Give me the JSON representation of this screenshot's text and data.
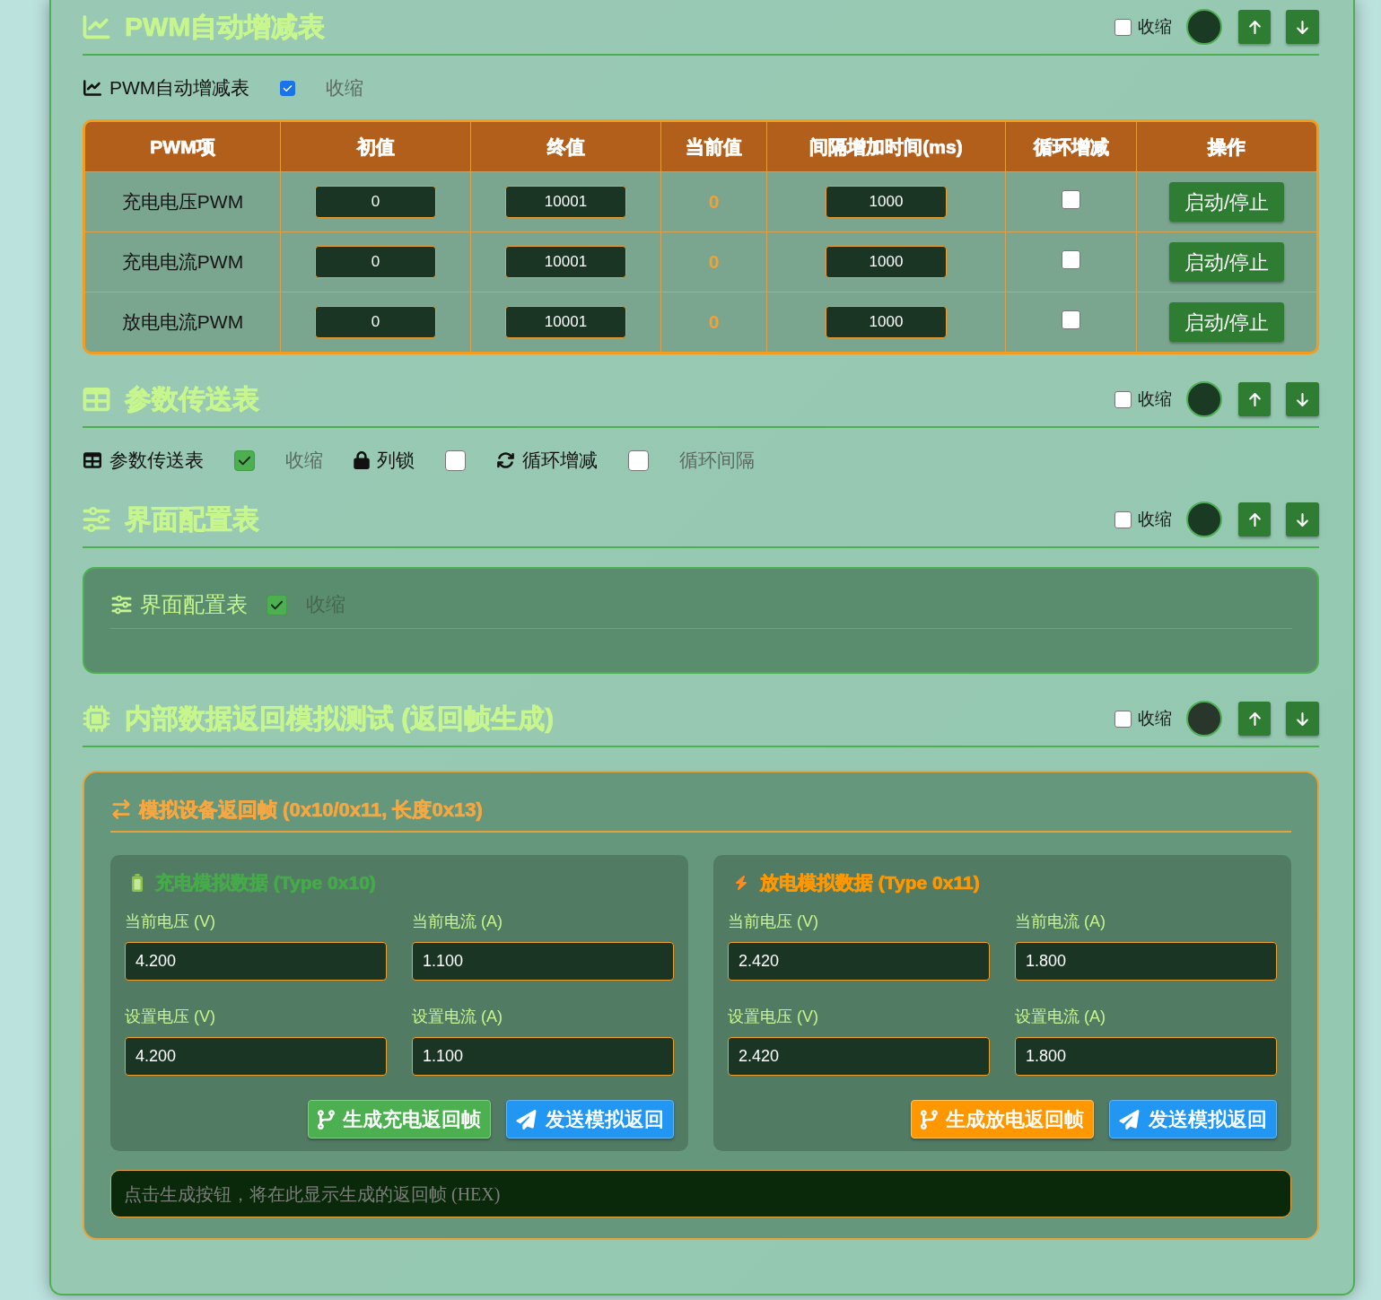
{
  "sections": [
    {
      "kind": "pwm",
      "title": "PWM自动增减表",
      "collapse": {
        "label": "收缩",
        "checked": false
      },
      "color": "#1a3a24",
      "toolbar": [
        {
          "kind": "heading",
          "label": "PWM自动增减表"
        },
        {
          "kind": "checkbox",
          "checked": true
        },
        {
          "kind": "hint",
          "label": "收缩"
        }
      ],
      "table": {
        "columns": [
          "PWM项",
          "初值",
          "终值",
          "当前值",
          "间隔增加时间(ms)",
          "循环增减",
          "操作"
        ],
        "rows": [
          {
            "name": "充电电压PWM",
            "start": "0",
            "end": "10001",
            "current": "0",
            "interval": "1000",
            "loop": false,
            "action": "启动/停止"
          },
          {
            "name": "充电电流PWM",
            "start": "0",
            "end": "10001",
            "current": "0",
            "interval": "1000",
            "loop": false,
            "action": "启动/停止"
          },
          {
            "name": "放电电流PWM",
            "start": "0",
            "end": "10001",
            "current": "0",
            "interval": "1000",
            "loop": false,
            "action": "启动/停止"
          }
        ]
      }
    },
    {
      "kind": "params",
      "title": "参数传送表",
      "collapse": {
        "label": "收缩",
        "checked": false
      },
      "color": "#1a3a24",
      "toolbar": [
        {
          "kind": "heading",
          "label": "参数传送表"
        },
        {
          "kind": "checkbox",
          "checked": true
        },
        {
          "kind": "hint",
          "label": "收缩"
        },
        {
          "kind": "lock",
          "label": "列锁"
        },
        {
          "kind": "checkbox",
          "checked": false
        },
        {
          "kind": "loop",
          "label": "循环增减"
        },
        {
          "kind": "checkbox",
          "checked": false
        },
        {
          "kind": "hint",
          "label": "循环间隔"
        }
      ]
    },
    {
      "kind": "ui_config",
      "title": "界面配置表",
      "collapse": {
        "label": "收缩",
        "checked": false
      },
      "color": "#1a3a24",
      "panel": {
        "items": [
          {
            "kind": "heading",
            "label": "界面配置表"
          },
          {
            "kind": "checkbox",
            "checked": true
          },
          {
            "kind": "hint",
            "label": "收缩"
          }
        ]
      }
    },
    {
      "kind": "simulation",
      "title": "内部数据返回模拟测试 (返回帧生成)",
      "collapse": {
        "label": "收缩",
        "checked": false
      },
      "color": "#29362b",
      "panel": {
        "title": "模拟设备返回帧 (0x10/0x11, 长度0x13)",
        "groups": [
          {
            "kind": "charge",
            "title": "充电模拟数据 (Type 0x10)",
            "fields": [
              {
                "label": "当前电压 (V)",
                "value": "4.200"
              },
              {
                "label": "当前电流 (A)",
                "value": "1.100"
              },
              {
                "label": "设置电压 (V)",
                "value": "4.200"
              },
              {
                "label": "设置电流 (A)",
                "value": "1.100"
              }
            ],
            "buttons": [
              {
                "kind": "generate",
                "label": "生成充电返回帧"
              },
              {
                "kind": "send",
                "label": "发送模拟返回"
              }
            ]
          },
          {
            "kind": "discharge",
            "title": "放电模拟数据 (Type 0x11)",
            "fields": [
              {
                "label": "当前电压 (V)",
                "value": "2.420"
              },
              {
                "label": "当前电流 (A)",
                "value": "1.800"
              },
              {
                "label": "设置电压 (V)",
                "value": "2.420"
              },
              {
                "label": "设置电流 (A)",
                "value": "1.800"
              }
            ],
            "buttons": [
              {
                "kind": "generate",
                "label": "生成放电返回帧"
              },
              {
                "kind": "send",
                "label": "发送模拟返回"
              }
            ]
          }
        ],
        "output": {
          "placeholder": "点击生成按钮，将在此显示生成的返回帧 (HEX)"
        }
      }
    }
  ]
}
